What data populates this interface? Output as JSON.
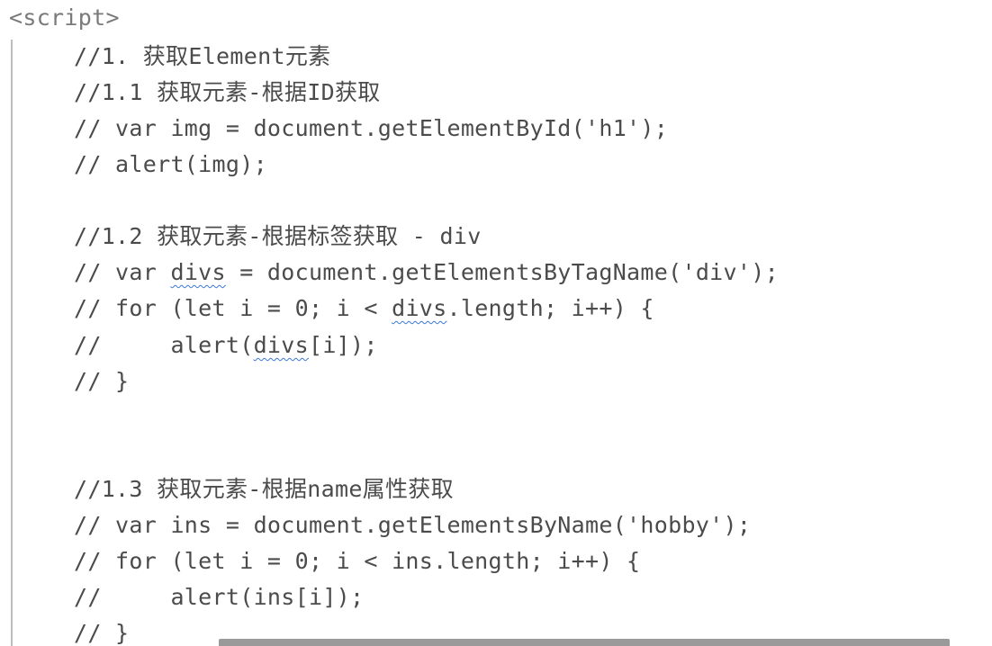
{
  "code": {
    "open_tag": "<script>",
    "l1": "//1. 获取Element元素",
    "l2": "//1.1 获取元素-根据ID获取",
    "l3": "// var img = document.getElementById('h1');",
    "l4": "// alert(img);",
    "l5": "//1.2 获取元素-根据标签获取 - div",
    "l6_pre": "// var ",
    "l6_var": "divs",
    "l6_post": " = document.getElementsByTagName('div');",
    "l7_pre": "// for (let i = 0; i < ",
    "l7_var": "divs",
    "l7_post": ".length; i++) {",
    "l8_pre": "//     alert(",
    "l8_var": "divs",
    "l8_post": "[i]);",
    "l9": "// }",
    "l10": "//1.3 获取元素-根据name属性获取",
    "l11": "// var ins = document.getElementsByName('hobby');",
    "l12": "// for (let i = 0; i < ins.length; i++) {",
    "l13": "//     alert(ins[i]);",
    "l14": "// }"
  },
  "colors": {
    "text": "#4b4b4b",
    "tag": "#7a7a7a",
    "squiggle": "#3b78d8"
  }
}
